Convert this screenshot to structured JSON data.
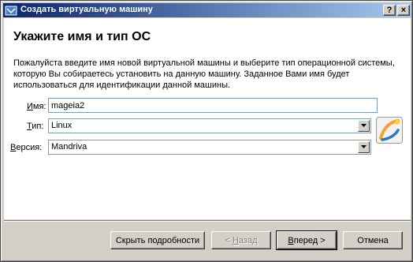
{
  "window": {
    "title": "Создать виртуальную машину",
    "icon": "virtualbox-app-icon",
    "help_button": "?",
    "close_button": "×"
  },
  "page": {
    "heading": "Укажите имя и тип ОС",
    "description": "Пожалуйста введите имя новой виртуальной машины и выберите тип операционной системы, которую Вы собираетесь установить на данную машину. Заданное Вами имя будет использоваться для идентификации данной машины."
  },
  "form": {
    "name": {
      "label_mnemonic": "И",
      "label_rest": "мя:",
      "value": "mageia2"
    },
    "type": {
      "label_mnemonic": "Т",
      "label_rest": "ип:",
      "value": "Linux"
    },
    "version": {
      "label_mnemonic": "В",
      "label_rest": "ерсия:",
      "value": "Mandriva"
    },
    "os_icon": "mandriva-os-icon"
  },
  "buttons": {
    "details": "Скрыть подробности",
    "back_mnemonic": "Н",
    "back_prefix": "< ",
    "back_rest": "азад",
    "next_mnemonic": "В",
    "next_rest": "перед >",
    "cancel": "Отмена"
  }
}
